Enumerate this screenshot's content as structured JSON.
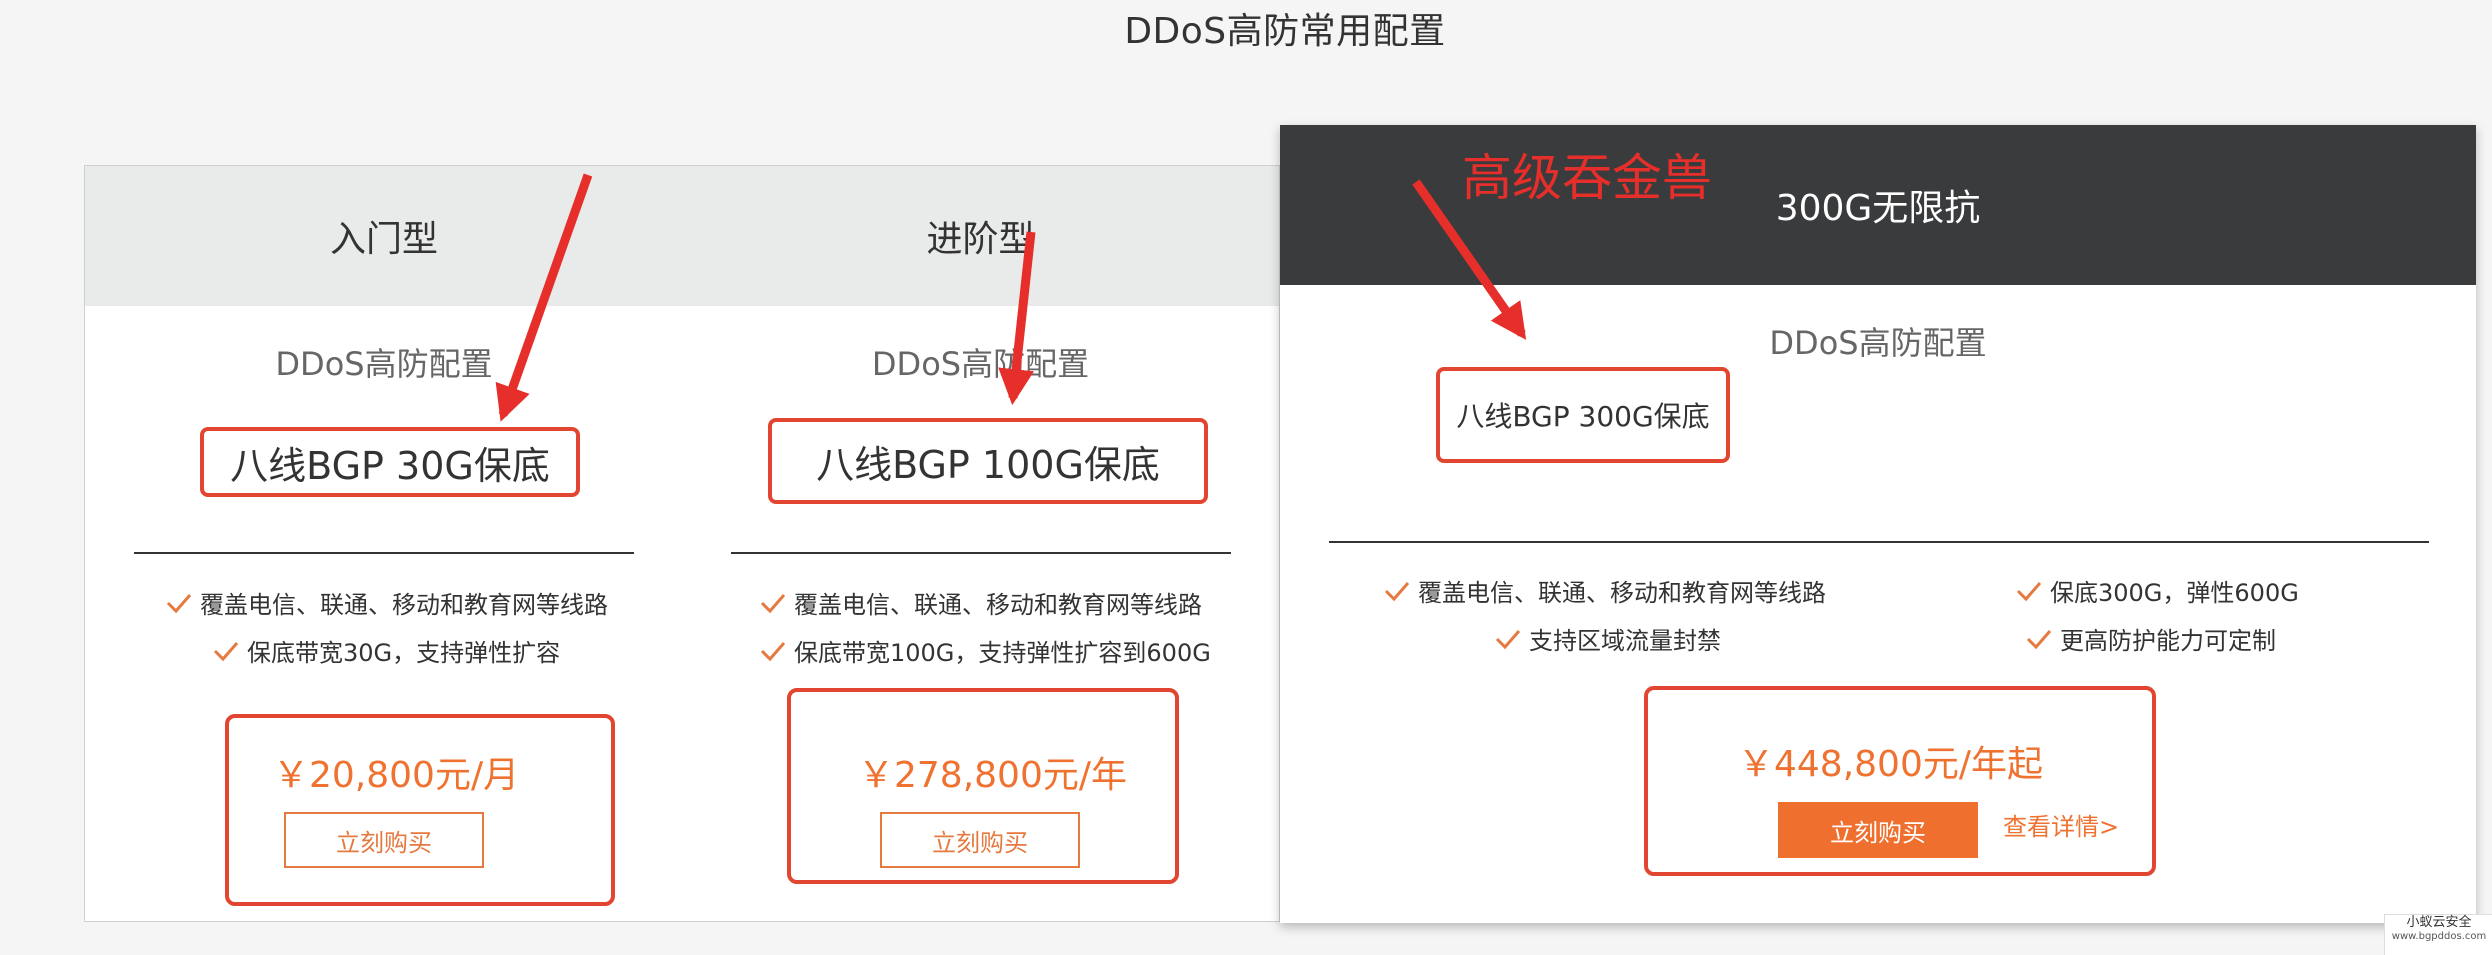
{
  "page_title": "DDoS高防常用配置",
  "cards": [
    {
      "header": "入门型",
      "subtitle": "DDoS高防配置",
      "spec": "八线BGP 30G保底",
      "features": [
        "覆盖电信、联通、移动和教育网等线路",
        "保底带宽30G，支持弹性扩容"
      ],
      "price": "￥20,800元/月",
      "buy_label": "立刻购买"
    },
    {
      "header": "进阶型",
      "subtitle": "DDoS高防配置",
      "spec": "八线BGP 100G保底",
      "features": [
        "覆盖电信、联通、移动和教育网等线路",
        "保底带宽100G，支持弹性扩容到600G"
      ],
      "price": "￥278,800元/年",
      "buy_label": "立刻购买"
    },
    {
      "header": "300G无限抗",
      "subtitle": "DDoS高防配置",
      "spec": "八线BGP 300G保底",
      "features": [
        "覆盖电信、联通、移动和教育网等线路",
        "支持区域流量封禁",
        "保底300G，弹性600G",
        "更高防护能力可定制"
      ],
      "price": "￥448,800元/年起",
      "buy_label": "立刻购买",
      "details_label": "查看详情>"
    }
  ],
  "annotation": "高级吞金兽",
  "watermark": {
    "line1": "小蚁云安全",
    "line2": "www.bgpddos.com"
  },
  "colors": {
    "accent": "#ee6f2e",
    "annotation_red": "#e62e2a",
    "dark_header": "#3a3b3d"
  },
  "icons": {
    "check": "check-icon",
    "arrow": "red-arrow-icon"
  }
}
